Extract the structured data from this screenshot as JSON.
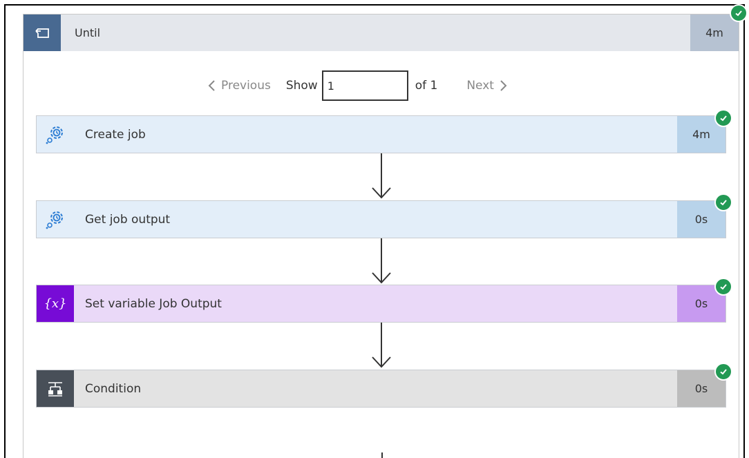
{
  "until": {
    "title": "Until",
    "duration": "4m",
    "icon": "loop-icon"
  },
  "pager": {
    "previous_label": "Previous",
    "show_label": "Show",
    "page_value": "1",
    "of_label": "of 1",
    "next_label": "Next"
  },
  "actions": [
    {
      "title": "Create job",
      "duration": "4m",
      "icon": "gear-clock-icon"
    },
    {
      "title": "Get job output",
      "duration": "0s",
      "icon": "gear-clock-icon"
    },
    {
      "title": "Set variable Job Output",
      "duration": "0s",
      "icon": "variable-icon",
      "icon_text": "{x}"
    },
    {
      "title": "Condition",
      "duration": "0s",
      "icon": "condition-icon"
    }
  ],
  "colors": {
    "success": "#229954",
    "until_icon_bg": "#486991",
    "automation_bg": "#e3eef9",
    "automation_dur_bg": "#b8d3ea",
    "automation_icon": "#2b7cd3",
    "variable_icon_bg": "#770bd6",
    "variable_bg": "#ead9f8",
    "variable_dur_bg": "#c79af0",
    "condition_icon_bg": "#484f58",
    "condition_bg": "#e3e3e3",
    "condition_dur_bg": "#bcbcbc"
  }
}
